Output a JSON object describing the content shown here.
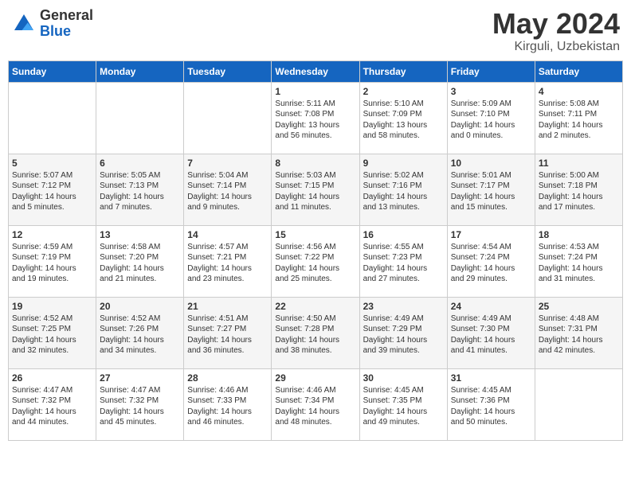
{
  "header": {
    "logo_general": "General",
    "logo_blue": "Blue",
    "month": "May 2024",
    "location": "Kirguli, Uzbekistan"
  },
  "weekdays": [
    "Sunday",
    "Monday",
    "Tuesday",
    "Wednesday",
    "Thursday",
    "Friday",
    "Saturday"
  ],
  "weeks": [
    [
      {
        "day": "",
        "content": ""
      },
      {
        "day": "",
        "content": ""
      },
      {
        "day": "",
        "content": ""
      },
      {
        "day": "1",
        "content": "Sunrise: 5:11 AM\nSunset: 7:08 PM\nDaylight: 13 hours\nand 56 minutes."
      },
      {
        "day": "2",
        "content": "Sunrise: 5:10 AM\nSunset: 7:09 PM\nDaylight: 13 hours\nand 58 minutes."
      },
      {
        "day": "3",
        "content": "Sunrise: 5:09 AM\nSunset: 7:10 PM\nDaylight: 14 hours\nand 0 minutes."
      },
      {
        "day": "4",
        "content": "Sunrise: 5:08 AM\nSunset: 7:11 PM\nDaylight: 14 hours\nand 2 minutes."
      }
    ],
    [
      {
        "day": "5",
        "content": "Sunrise: 5:07 AM\nSunset: 7:12 PM\nDaylight: 14 hours\nand 5 minutes."
      },
      {
        "day": "6",
        "content": "Sunrise: 5:05 AM\nSunset: 7:13 PM\nDaylight: 14 hours\nand 7 minutes."
      },
      {
        "day": "7",
        "content": "Sunrise: 5:04 AM\nSunset: 7:14 PM\nDaylight: 14 hours\nand 9 minutes."
      },
      {
        "day": "8",
        "content": "Sunrise: 5:03 AM\nSunset: 7:15 PM\nDaylight: 14 hours\nand 11 minutes."
      },
      {
        "day": "9",
        "content": "Sunrise: 5:02 AM\nSunset: 7:16 PM\nDaylight: 14 hours\nand 13 minutes."
      },
      {
        "day": "10",
        "content": "Sunrise: 5:01 AM\nSunset: 7:17 PM\nDaylight: 14 hours\nand 15 minutes."
      },
      {
        "day": "11",
        "content": "Sunrise: 5:00 AM\nSunset: 7:18 PM\nDaylight: 14 hours\nand 17 minutes."
      }
    ],
    [
      {
        "day": "12",
        "content": "Sunrise: 4:59 AM\nSunset: 7:19 PM\nDaylight: 14 hours\nand 19 minutes."
      },
      {
        "day": "13",
        "content": "Sunrise: 4:58 AM\nSunset: 7:20 PM\nDaylight: 14 hours\nand 21 minutes."
      },
      {
        "day": "14",
        "content": "Sunrise: 4:57 AM\nSunset: 7:21 PM\nDaylight: 14 hours\nand 23 minutes."
      },
      {
        "day": "15",
        "content": "Sunrise: 4:56 AM\nSunset: 7:22 PM\nDaylight: 14 hours\nand 25 minutes."
      },
      {
        "day": "16",
        "content": "Sunrise: 4:55 AM\nSunset: 7:23 PM\nDaylight: 14 hours\nand 27 minutes."
      },
      {
        "day": "17",
        "content": "Sunrise: 4:54 AM\nSunset: 7:24 PM\nDaylight: 14 hours\nand 29 minutes."
      },
      {
        "day": "18",
        "content": "Sunrise: 4:53 AM\nSunset: 7:24 PM\nDaylight: 14 hours\nand 31 minutes."
      }
    ],
    [
      {
        "day": "19",
        "content": "Sunrise: 4:52 AM\nSunset: 7:25 PM\nDaylight: 14 hours\nand 32 minutes."
      },
      {
        "day": "20",
        "content": "Sunrise: 4:52 AM\nSunset: 7:26 PM\nDaylight: 14 hours\nand 34 minutes."
      },
      {
        "day": "21",
        "content": "Sunrise: 4:51 AM\nSunset: 7:27 PM\nDaylight: 14 hours\nand 36 minutes."
      },
      {
        "day": "22",
        "content": "Sunrise: 4:50 AM\nSunset: 7:28 PM\nDaylight: 14 hours\nand 38 minutes."
      },
      {
        "day": "23",
        "content": "Sunrise: 4:49 AM\nSunset: 7:29 PM\nDaylight: 14 hours\nand 39 minutes."
      },
      {
        "day": "24",
        "content": "Sunrise: 4:49 AM\nSunset: 7:30 PM\nDaylight: 14 hours\nand 41 minutes."
      },
      {
        "day": "25",
        "content": "Sunrise: 4:48 AM\nSunset: 7:31 PM\nDaylight: 14 hours\nand 42 minutes."
      }
    ],
    [
      {
        "day": "26",
        "content": "Sunrise: 4:47 AM\nSunset: 7:32 PM\nDaylight: 14 hours\nand 44 minutes."
      },
      {
        "day": "27",
        "content": "Sunrise: 4:47 AM\nSunset: 7:32 PM\nDaylight: 14 hours\nand 45 minutes."
      },
      {
        "day": "28",
        "content": "Sunrise: 4:46 AM\nSunset: 7:33 PM\nDaylight: 14 hours\nand 46 minutes."
      },
      {
        "day": "29",
        "content": "Sunrise: 4:46 AM\nSunset: 7:34 PM\nDaylight: 14 hours\nand 48 minutes."
      },
      {
        "day": "30",
        "content": "Sunrise: 4:45 AM\nSunset: 7:35 PM\nDaylight: 14 hours\nand 49 minutes."
      },
      {
        "day": "31",
        "content": "Sunrise: 4:45 AM\nSunset: 7:36 PM\nDaylight: 14 hours\nand 50 minutes."
      },
      {
        "day": "",
        "content": ""
      }
    ]
  ]
}
